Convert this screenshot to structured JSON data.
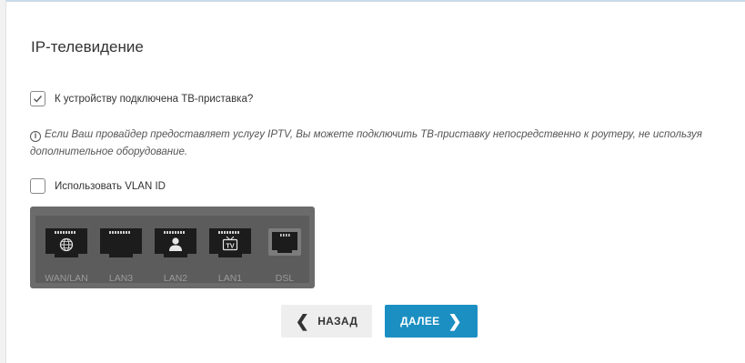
{
  "page": {
    "title": "IP-телевидение"
  },
  "stb_checkbox": {
    "label": "К устройству подключена ТВ-приставка?",
    "checked": true
  },
  "info": {
    "text": "Если Ваш провайдер предоставляет услугу IPTV, Вы можете подключить ТВ-приставку непосредственно к роутеру, не используя дополнительное оборудование."
  },
  "vlan_checkbox": {
    "label": "Использовать VLAN ID",
    "checked": false
  },
  "ports": [
    {
      "label": "WAN/LAN",
      "icon": "globe-icon"
    },
    {
      "label": "LAN3",
      "icon": "none"
    },
    {
      "label": "LAN2",
      "icon": "user-icon"
    },
    {
      "label": "LAN1",
      "icon": "tv-icon"
    },
    {
      "label": "DSL",
      "icon": "none"
    }
  ],
  "tv_icon_text": "TV",
  "buttons": {
    "back": "НАЗАД",
    "next": "ДАЛЕЕ"
  },
  "colors": {
    "accent": "#1b8fc2",
    "port_panel": "#6b6b6b"
  }
}
